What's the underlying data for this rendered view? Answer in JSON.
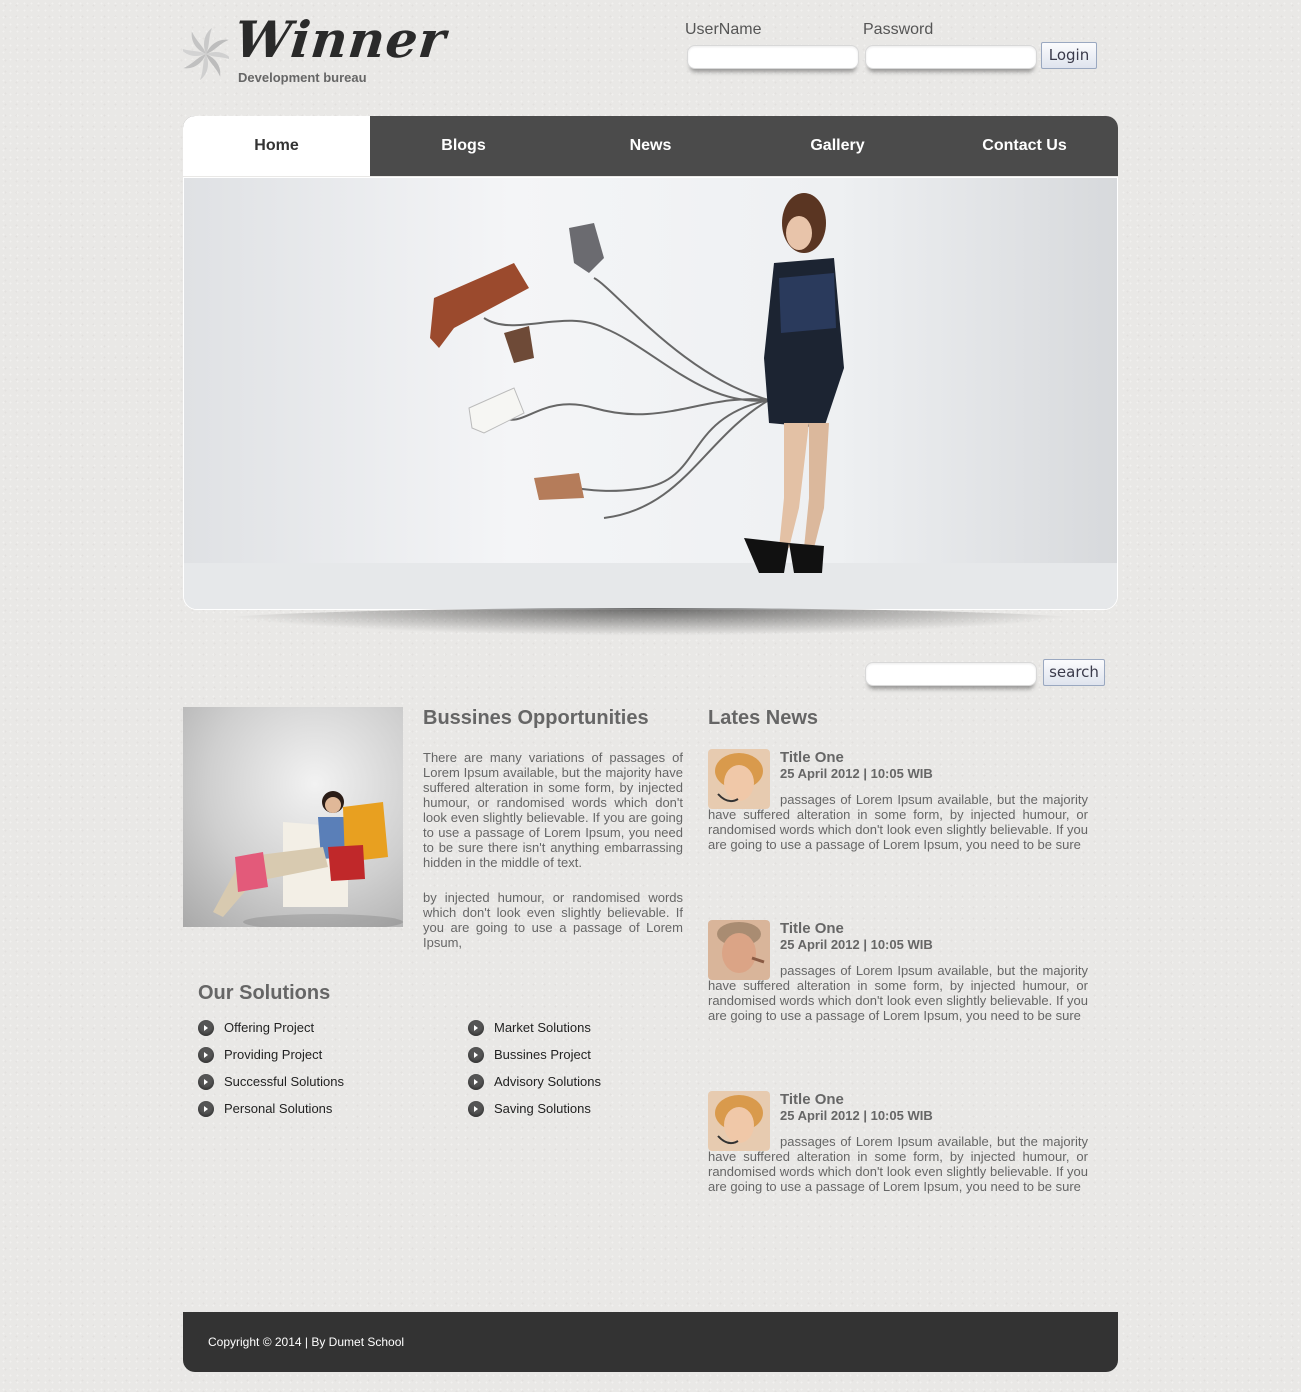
{
  "brand": {
    "name": "Winner",
    "tagline": "Development bureau"
  },
  "login": {
    "username_label": "UserName",
    "password_label": "Password",
    "username_value": "",
    "password_value": "",
    "button": "Login"
  },
  "nav": {
    "items": [
      "Home",
      "Blogs",
      "News",
      "Gallery",
      "Contact Us"
    ],
    "active": "Home"
  },
  "search": {
    "value": "",
    "button": "search"
  },
  "business": {
    "title": "Bussines Opportunities",
    "p1": "There are many variations of passages of Lorem Ipsum available, but the majority have suffered alteration in some form, by injected humour, or randomised words which don't look even slightly believable. If you are going to use a passage of Lorem Ipsum, you need to be sure there isn't anything embarrassing hidden in the middle of text.",
    "p2": "by injected humour, or randomised words which don't look even slightly believable. If you are going to use a passage of Lorem Ipsum,"
  },
  "solutions": {
    "title": "Our Solutions",
    "left": [
      "Offering Project",
      "Providing Project",
      "Successful Solutions",
      "Personal Solutions"
    ],
    "right": [
      "Market Solutions",
      "Bussines Project",
      "Advisory Solutions",
      "Saving Solutions"
    ]
  },
  "news": {
    "title": "Lates News",
    "items": [
      {
        "title": "Title One",
        "date": "25 April 2012 | 10:05 WIB",
        "text": "passages of Lorem Ipsum available, but the majority have suffered alteration in some form, by injected humour, or randomised words which don't look even slightly believable. If you are going to use a passage of Lorem Ipsum, you need to be sure"
      },
      {
        "title": "Title One",
        "date": "25 April 2012 | 10:05 WIB",
        "text": "passages of Lorem Ipsum available, but the majority have suffered alteration in some form, by injected humour, or randomised words which don't look even slightly believable. If you are going to use a passage of Lorem Ipsum, you need to be sure"
      },
      {
        "title": "Title One",
        "date": "25 April 2012 | 10:05 WIB",
        "text": "passages of Lorem Ipsum available, but the majority have suffered alteration in some form, by injected humour, or randomised words which don't look even slightly believable. If you are going to use a passage of Lorem Ipsum, you need to be sure"
      }
    ]
  },
  "footer": {
    "text": "Copyright © 2014 | By Dumet School"
  },
  "colors": {
    "nav_bg": "#4b4b4b",
    "footer_bg": "#333333",
    "page_bg": "#e9e8e6"
  }
}
